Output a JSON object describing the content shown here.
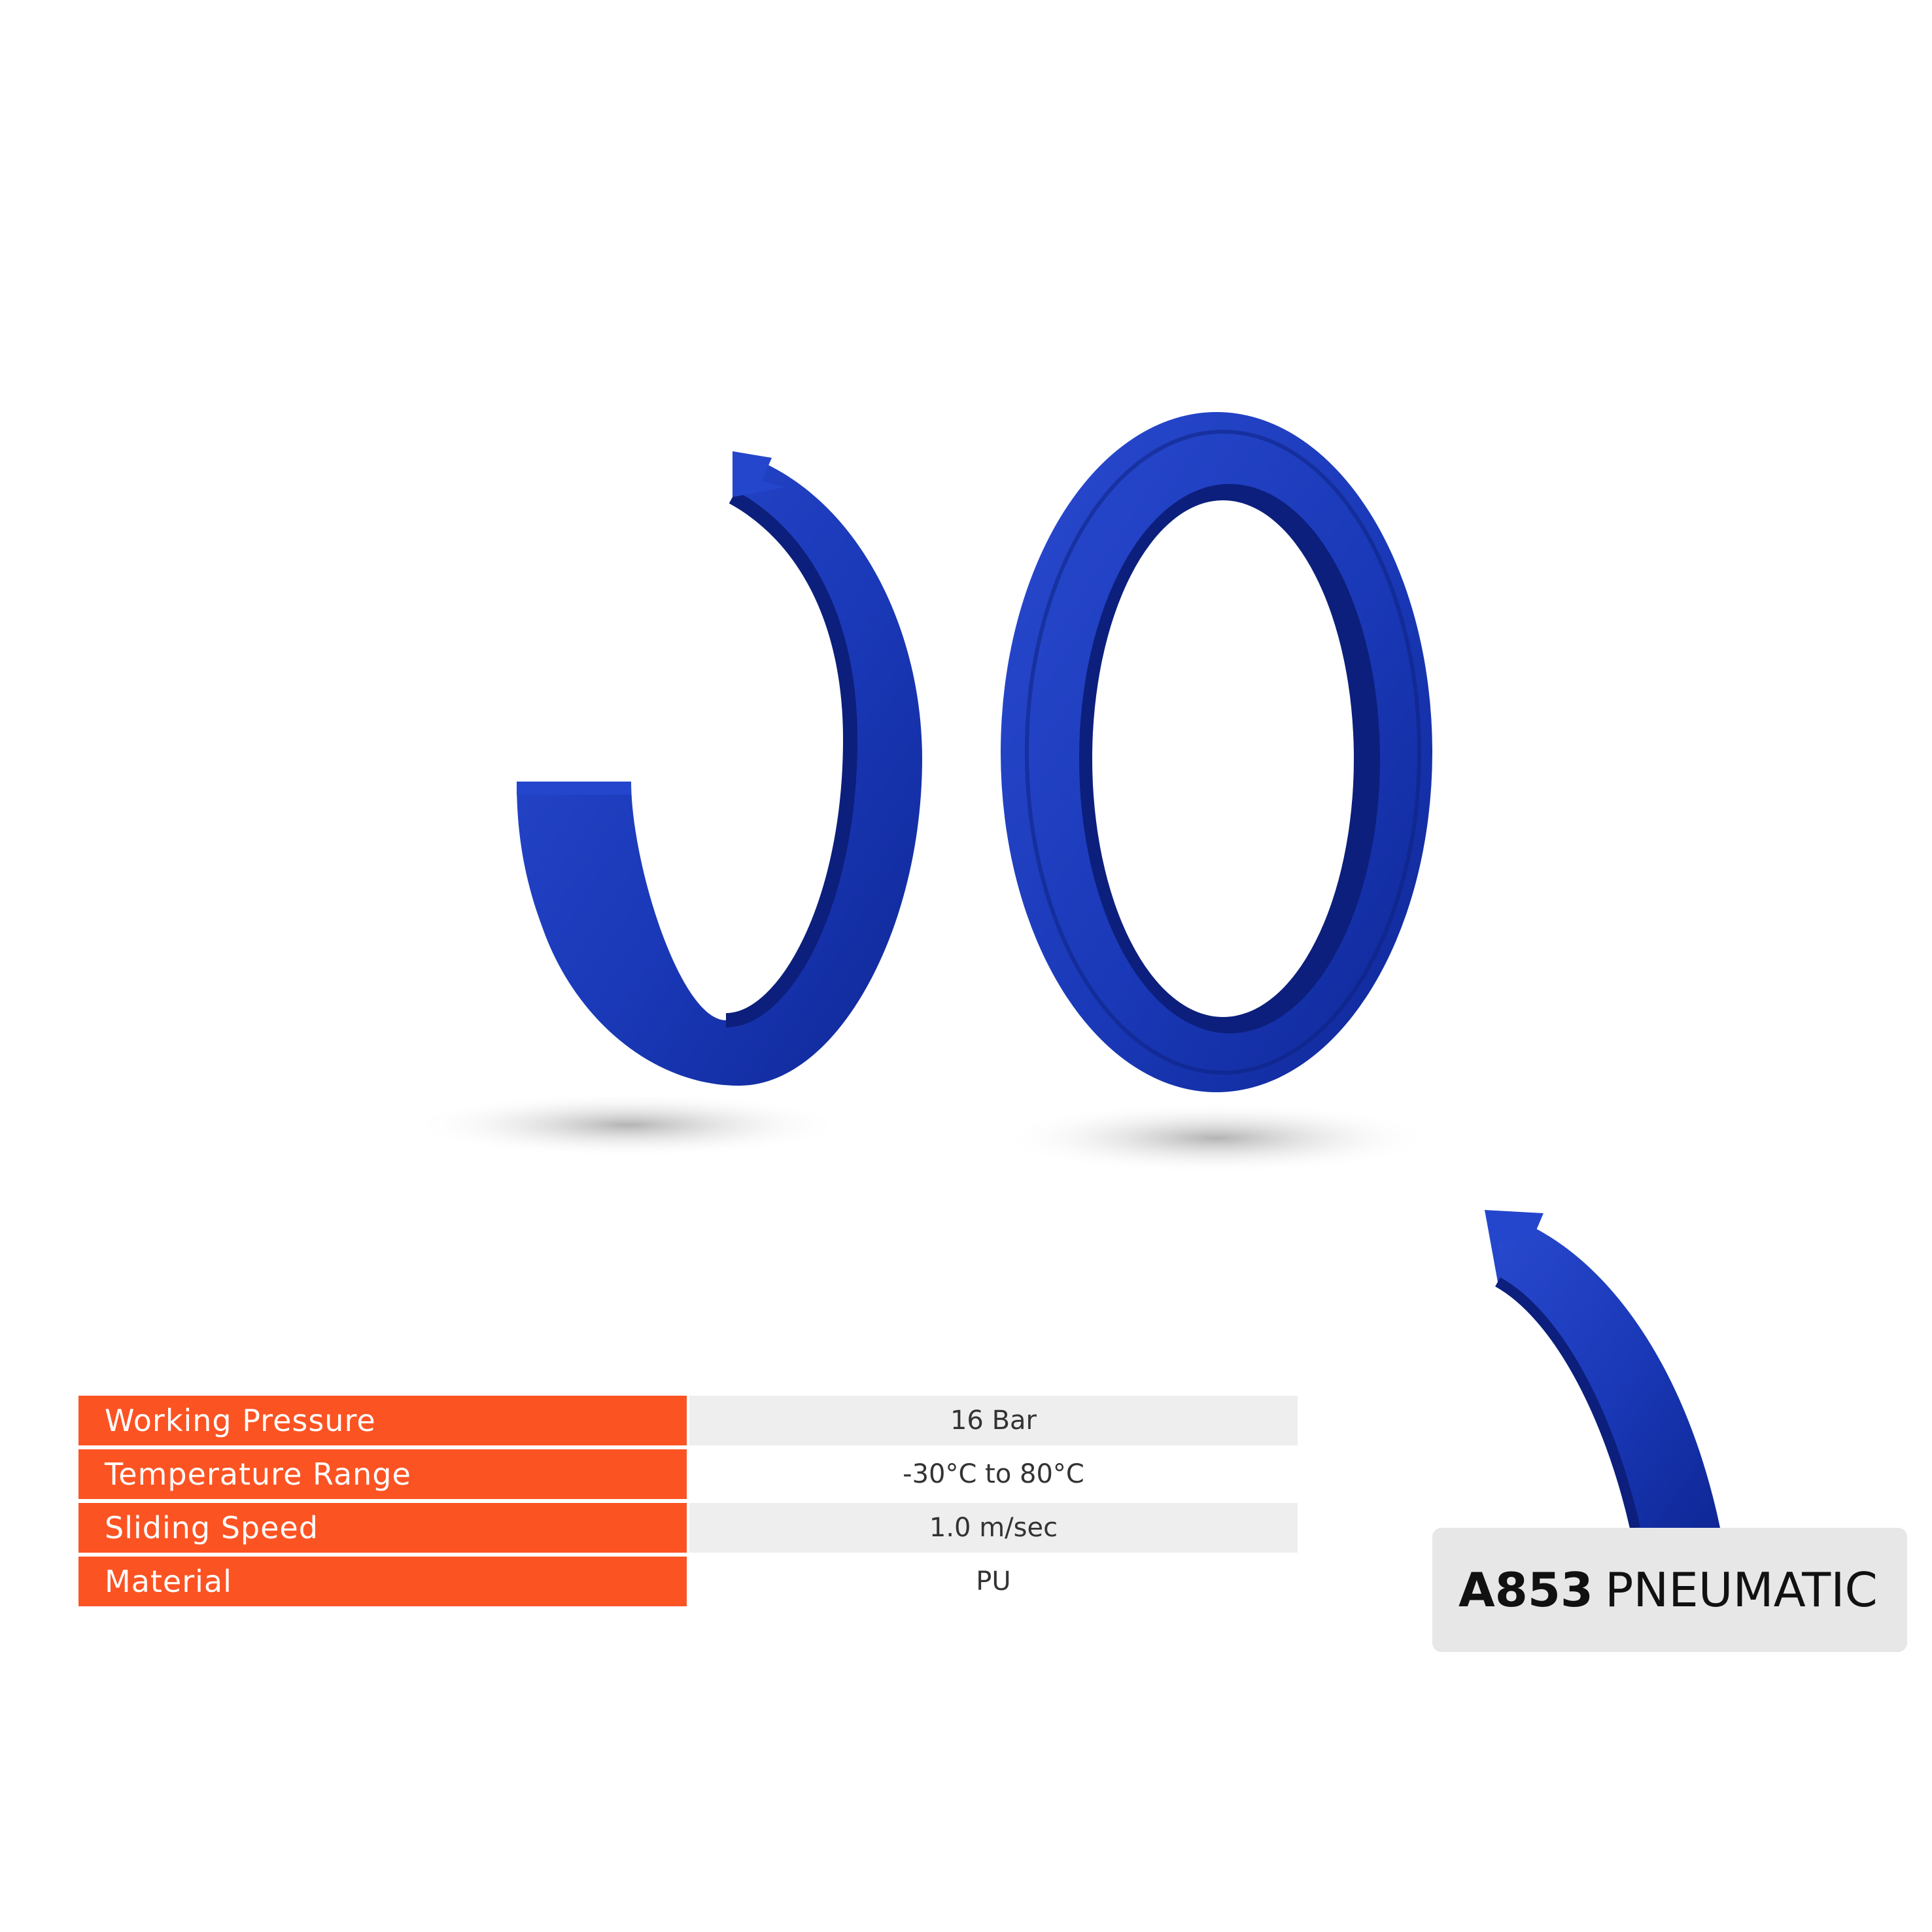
{
  "colors": {
    "accent": "#fc5323",
    "seal_blue": "#1a39b8",
    "seal_dark": "#0c1f7c",
    "card_bg": "#e7e7e7"
  },
  "specs": [
    {
      "label": "Working Pressure",
      "value": "16 Bar"
    },
    {
      "label": "Temperature Range",
      "value": "-30°C to 80°C"
    },
    {
      "label": "Sliding Speed",
      "value": "1.0 m/sec"
    },
    {
      "label": "Material",
      "value": "PU"
    }
  ],
  "product": {
    "code": "A853",
    "type": "PNEUMATIC"
  }
}
